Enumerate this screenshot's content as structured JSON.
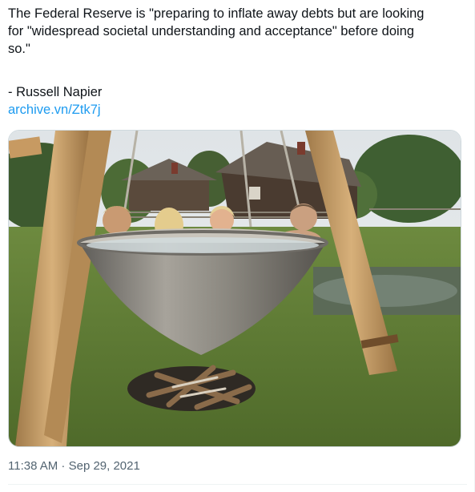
{
  "tweet": {
    "text": "The Federal Reserve is \"preparing to inflate away debts but are looking\nfor \"widespread societal understanding and acceptance\" before doing\nso.\"",
    "author_line": "- Russell Napier",
    "link_text": "archive.vn/Ztk7j",
    "timestamp": "11:38 AM · Sep 29, 2021"
  },
  "colors": {
    "link": "#1d9bf0",
    "text": "#0f1419",
    "muted": "#536471",
    "border": "#cfd9de"
  }
}
